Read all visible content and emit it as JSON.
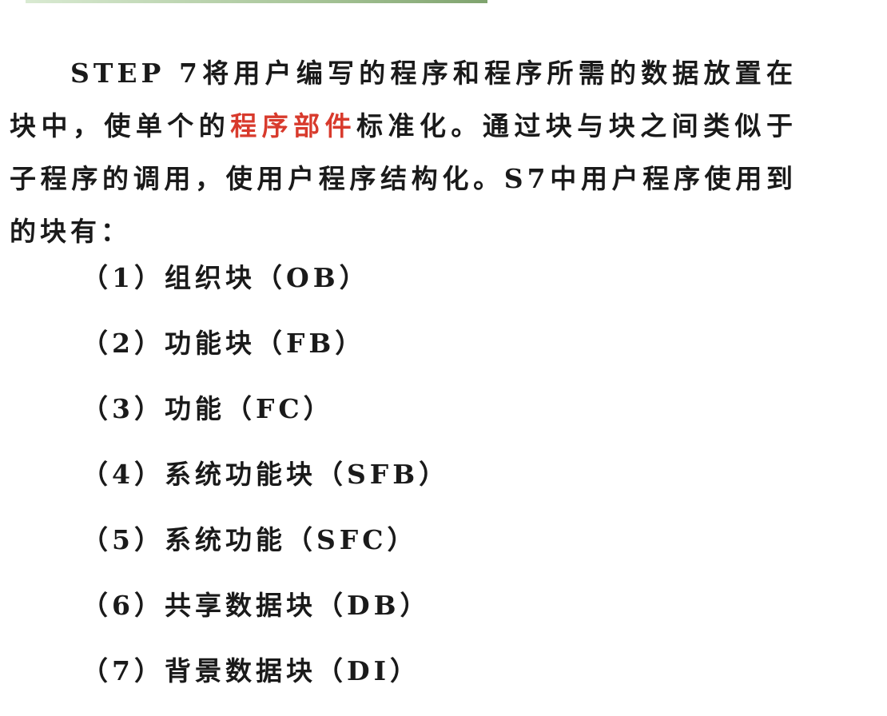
{
  "intro": {
    "part1": "STEP 7将用户编写的程序和程序所需的数据放置在块中，使单个的",
    "highlight": "程序部件",
    "part2": "标准化。通过块与块之间类似于子程序的调用，使用户程序结构化。S7中用户程序使用到的块有："
  },
  "blocks": [
    "（1）组织块（OB）",
    "（2）功能块（FB）",
    "（3）功能（FC）",
    "（4）系统功能块（SFB）",
    "（5）系统功能（SFC）",
    "（6）共享数据块（DB）",
    "（7）背景数据块（DI）"
  ],
  "colors": {
    "highlight": "#d83a2c",
    "text": "#1a1a1a",
    "top_bar": "#a9c69a"
  }
}
